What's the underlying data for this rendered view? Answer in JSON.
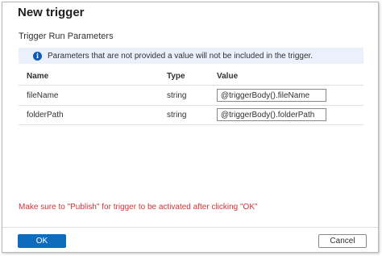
{
  "dialog": {
    "title": "New trigger",
    "subtitle": "Trigger Run Parameters",
    "info_text": "Parameters that are not provided a value will not be included in the trigger.",
    "info_icon": "info-icon",
    "warning": "Make sure to \"Publish\" for trigger to be activated after clicking \"OK\""
  },
  "table": {
    "columns": [
      "Name",
      "Type",
      "Value"
    ],
    "rows": [
      {
        "name": "fileName",
        "type": "string",
        "value": "@triggerBody().fileName"
      },
      {
        "name": "folderPath",
        "type": "string",
        "value": "@triggerBody().folderPath"
      }
    ]
  },
  "buttons": {
    "ok_label": "OK",
    "cancel_label": "Cancel"
  },
  "colors": {
    "accent": "#0f6cbd",
    "info_bg": "#eaf1fb",
    "warning": "#d13438"
  }
}
